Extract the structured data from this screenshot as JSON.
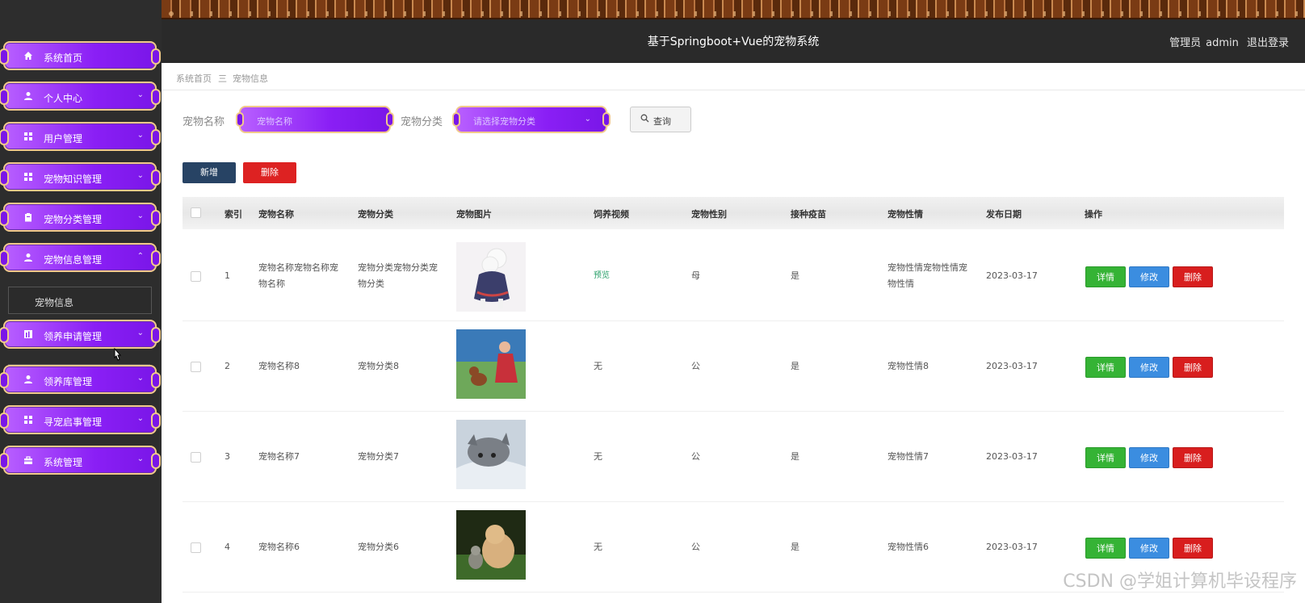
{
  "header": {
    "title": "基于Springboot+Vue的宠物系统",
    "user_role": "管理员",
    "username": "admin",
    "logout": "退出登录"
  },
  "sidebar": {
    "items": [
      {
        "label": "系统首页",
        "icon": "home-icon"
      },
      {
        "label": "个人中心",
        "icon": "person-icon"
      },
      {
        "label": "用户管理",
        "icon": "grid-icon"
      },
      {
        "label": "宠物知识管理",
        "icon": "grid-icon"
      },
      {
        "label": "宠物分类管理",
        "icon": "clipboard-icon"
      },
      {
        "label": "宠物信息管理",
        "icon": "person-icon"
      },
      {
        "label": "领养申请管理",
        "icon": "chart-icon"
      },
      {
        "label": "领养库管理",
        "icon": "person-icon"
      },
      {
        "label": "寻宠启事管理",
        "icon": "grid-icon"
      },
      {
        "label": "系统管理",
        "icon": "briefcase-icon"
      }
    ],
    "sub_item": "宠物信息"
  },
  "breadcrumb": {
    "home": "系统首页",
    "separator": "三",
    "current": "宠物信息"
  },
  "search": {
    "name_label": "宠物名称",
    "name_placeholder": "宠物名称",
    "category_label": "宠物分类",
    "category_placeholder": "请选择宠物分类",
    "query_button": "查询"
  },
  "toolbar": {
    "add": "新增",
    "delete": "删除"
  },
  "table": {
    "columns": [
      "索引",
      "宠物名称",
      "宠物分类",
      "宠物图片",
      "饲养视频",
      "宠物性别",
      "接种疫苗",
      "宠物性情",
      "发布日期",
      "操作"
    ],
    "rows": [
      {
        "index": "1",
        "name": "宠物名称宠物名称宠物名称",
        "category": "宠物分类宠物分类宠物分类",
        "video": "预览",
        "gender": "母",
        "vaccine": "是",
        "temper": "宠物性情宠物性情宠物性情",
        "date": "2023-03-17"
      },
      {
        "index": "2",
        "name": "宠物名称8",
        "category": "宠物分类8",
        "video": "无",
        "gender": "公",
        "vaccine": "是",
        "temper": "宠物性情8",
        "date": "2023-03-17"
      },
      {
        "index": "3",
        "name": "宠物名称7",
        "category": "宠物分类7",
        "video": "无",
        "gender": "公",
        "vaccine": "是",
        "temper": "宠物性情7",
        "date": "2023-03-17"
      },
      {
        "index": "4",
        "name": "宠物名称6",
        "category": "宠物分类6",
        "video": "无",
        "gender": "公",
        "vaccine": "是",
        "temper": "宠物性情6",
        "date": "2023-03-17"
      }
    ],
    "actions": {
      "detail": "详情",
      "edit": "修改",
      "remove": "删除"
    }
  },
  "watermark": "CSDN @学姐计算机毕设程序",
  "colors": {
    "menu_purple": "#8a1ff5",
    "menu_border": "#f1c98a",
    "header_bg": "#2a2a2a",
    "add_btn": "#274364",
    "delete_btn": "#dd2222",
    "detail_btn": "#35b335",
    "edit_btn": "#3b8de0"
  }
}
